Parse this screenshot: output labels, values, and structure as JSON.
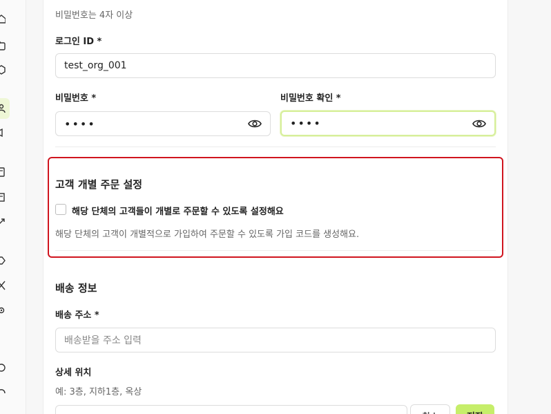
{
  "account": {
    "password_hint": "비밀번호는 4자 이상",
    "login_id_label": "로그인 ID *",
    "login_id_value": "test_org_001",
    "password_label": "비밀번호 *",
    "password_value": "••••",
    "password_confirm_label": "비밀번호 확인 *",
    "password_confirm_value": "••••"
  },
  "individual_order": {
    "title": "고객 개별 주문 설정",
    "checkbox_label": "해당 단체의 고객들이 개별로 주문할 수 있도록 설정해요",
    "checked": false,
    "description": "해당 단체의 고객이 개별적으로 가입하여 주문할 수 있도록 가입 코드를 생성해요."
  },
  "shipping": {
    "title": "배송 정보",
    "address_label": "배송 주소 *",
    "address_placeholder": "배송받을 주소 입력",
    "detail_label": "상세 위치",
    "detail_hint": "예: 3층, 지하1층, 옥상",
    "cancel_button": "취소",
    "save_button": "저장"
  },
  "sidebar": {
    "icons": [
      "home-icon",
      "calendar-icon",
      "box-icon",
      "users-icon",
      "megaphone-icon",
      "document-icon",
      "building-icon",
      "chart-icon",
      "tag-icon",
      "tools-icon",
      "gear-icon",
      "help-icon",
      "headset-icon"
    ],
    "active_icon": "users-icon"
  },
  "colors": {
    "accent": "#c6ee6a",
    "focus_border": "#d6ef9a",
    "highlight_border": "#d0141e"
  }
}
